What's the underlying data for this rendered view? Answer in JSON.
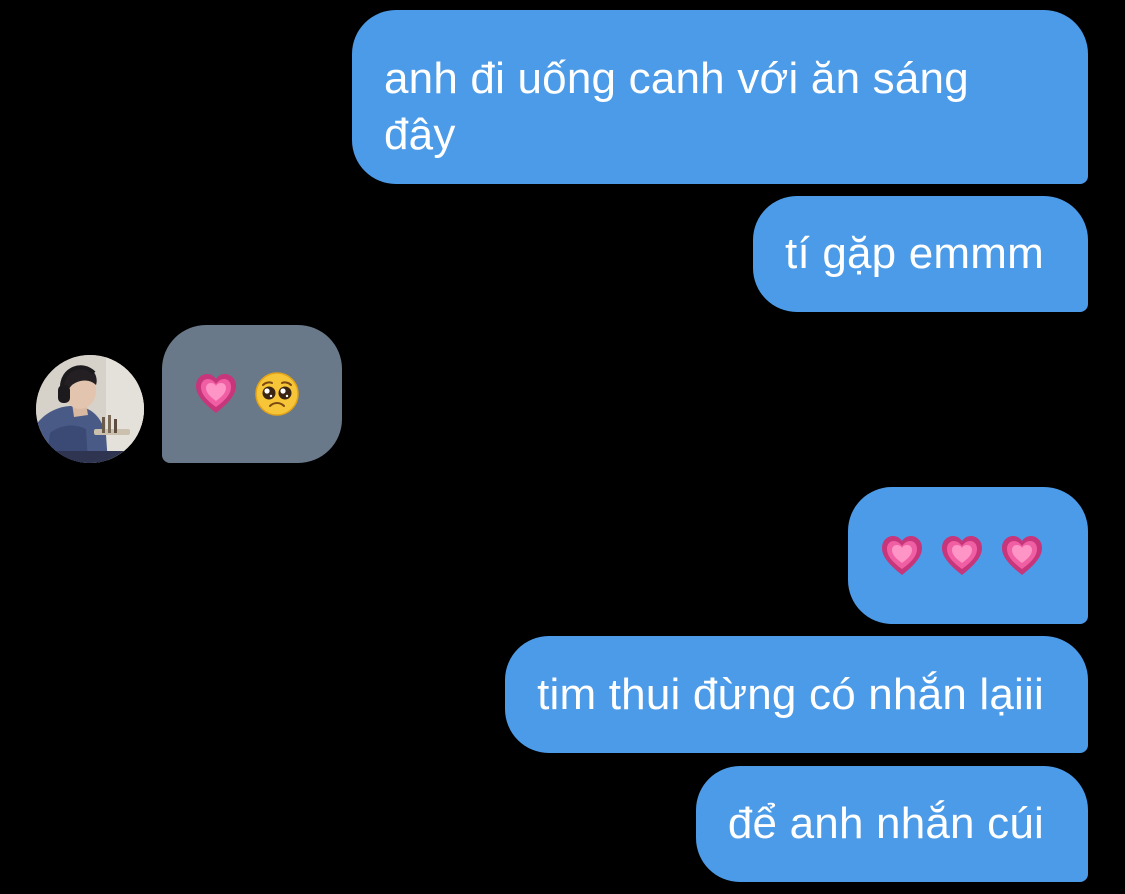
{
  "conversation": {
    "messages": [
      {
        "direction": "sent",
        "text": "anh đi uống canh với ăn sáng đây"
      },
      {
        "direction": "sent",
        "text": "tí gặp emmm"
      },
      {
        "direction": "received",
        "emojis": [
          "growing-heart-emoji",
          "pleading-face-emoji"
        ]
      },
      {
        "direction": "sent",
        "emojis": [
          "growing-heart-emoji",
          "growing-heart-emoji",
          "growing-heart-emoji"
        ]
      },
      {
        "direction": "sent",
        "text": "tim thui đừng có nhắn lạiii"
      },
      {
        "direction": "sent",
        "text": "để anh nhắn cúi"
      }
    ]
  },
  "colors": {
    "background": "#000000",
    "sent_bubble": "#4c9be8",
    "received_bubble": "#69798a",
    "bubble_text": "#ffffff"
  }
}
